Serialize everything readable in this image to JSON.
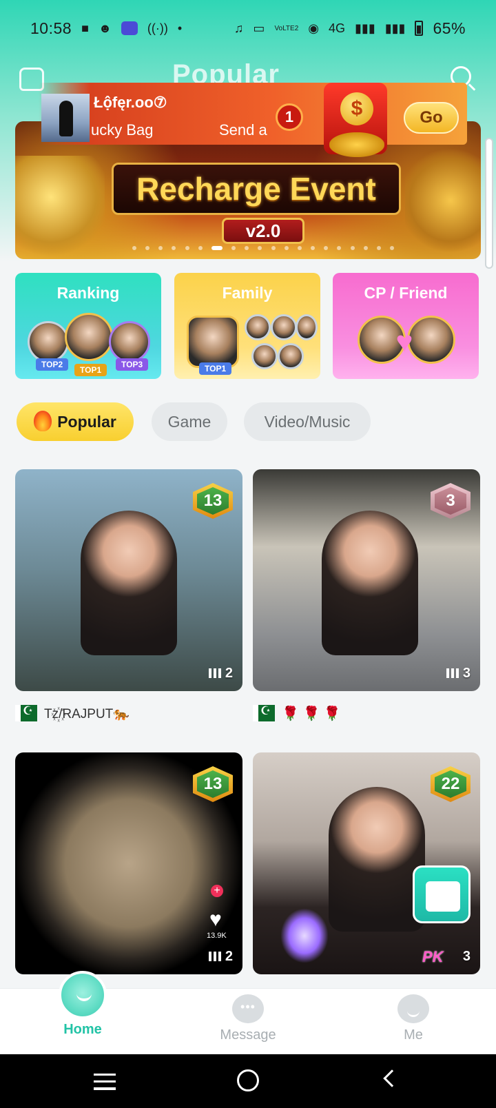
{
  "status_bar": {
    "time": "10:58",
    "network": "4G",
    "lte_label": "VoLTE2",
    "battery": "65%"
  },
  "header": {
    "title": "Popular"
  },
  "notification": {
    "user_name": "Łộfęr.oo⑦",
    "message_part1": "ucky Bag",
    "message_part2": "Send a",
    "count": "1",
    "coin_symbol": "$",
    "go_label": "Go"
  },
  "banner": {
    "title": "Recharge Event",
    "version": "v2.0"
  },
  "categories": [
    {
      "title": "Ranking",
      "badges": [
        "TOP2",
        "TOP1",
        "TOP3"
      ]
    },
    {
      "title": "Family",
      "badges": [
        "TOP1"
      ]
    },
    {
      "title": "CP / Friend"
    }
  ],
  "tabs": [
    {
      "label": "Popular",
      "active": true
    },
    {
      "label": "Game",
      "active": false
    },
    {
      "label": "Video/Music",
      "active": false
    }
  ],
  "rooms": [
    {
      "level": "13",
      "listeners": "2",
      "owner": "Tz꙰/RAJPUT🐅"
    },
    {
      "level": "3",
      "listeners": "3",
      "owner": "🌹 🌹 🌹"
    },
    {
      "level": "13",
      "listeners": "2",
      "side_count": "13.9K"
    },
    {
      "level": "22",
      "listeners": "3",
      "pk_label": "PK"
    }
  ],
  "bottom_nav": [
    {
      "label": "Home",
      "active": true
    },
    {
      "label": "Message",
      "active": false
    },
    {
      "label": "Me",
      "active": false
    }
  ],
  "colors": {
    "accent": "#22c3a6",
    "popular_tab": "#f8cf2f",
    "notification": "#f0612a"
  }
}
